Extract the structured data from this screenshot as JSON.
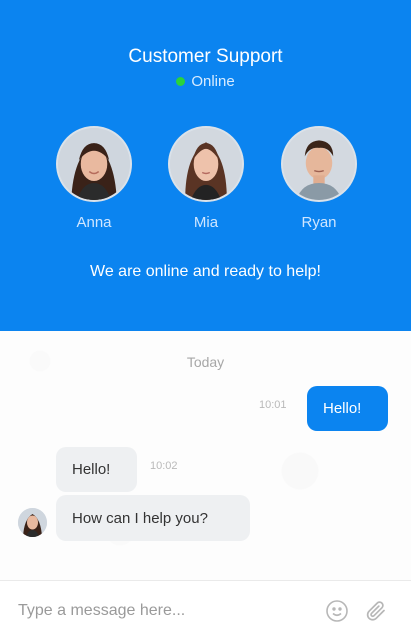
{
  "header": {
    "title": "Customer Support",
    "status": "Online",
    "status_color": "#2ad33a",
    "background": "#0b84f0",
    "tagline": "We are online and ready to help!"
  },
  "agents": [
    {
      "name": "Anna",
      "avatar": "woman-avatar"
    },
    {
      "name": "Mia",
      "avatar": "woman-avatar"
    },
    {
      "name": "Ryan",
      "avatar": "man-avatar"
    }
  ],
  "chat": {
    "day_label": "Today",
    "messages": [
      {
        "direction": "outgoing",
        "text": "Hello!",
        "time": "10:01"
      },
      {
        "direction": "incoming",
        "text": "Hello!",
        "time": "10:02"
      },
      {
        "direction": "incoming",
        "text": "How can I help you?",
        "time": ""
      }
    ]
  },
  "composer": {
    "placeholder": "Type a message here...",
    "value": "",
    "emoji_icon": "smiley-icon",
    "attach_icon": "paperclip-icon"
  }
}
